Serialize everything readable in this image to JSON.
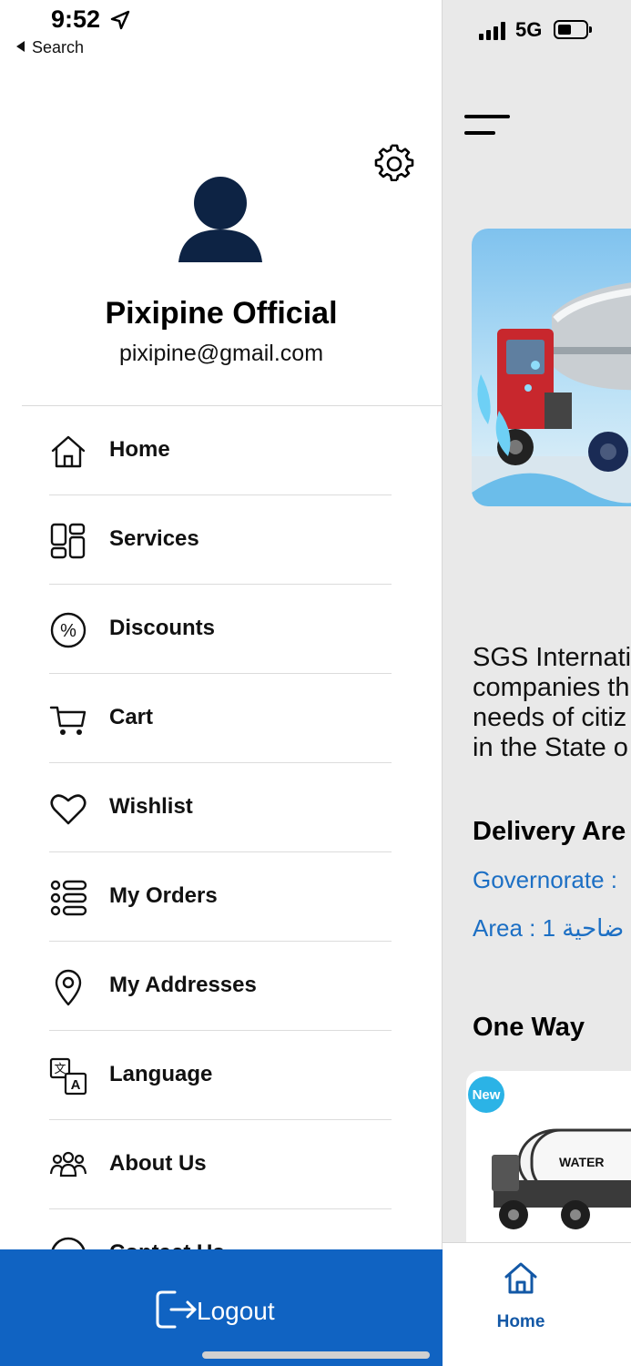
{
  "status_bar": {
    "time": "9:52",
    "back_label": "Search",
    "network": "5G"
  },
  "drawer": {
    "user_name": "Pixipine Official",
    "user_email": "pixipine@gmail.com",
    "menu_items": [
      {
        "label": "Home",
        "icon": "home-icon"
      },
      {
        "label": "Services",
        "icon": "services-grid-icon"
      },
      {
        "label": "Discounts",
        "icon": "percent-icon"
      },
      {
        "label": "Cart",
        "icon": "cart-icon"
      },
      {
        "label": "Wishlist",
        "icon": "heart-icon"
      },
      {
        "label": "My Orders",
        "icon": "list-icon"
      },
      {
        "label": "My Addresses",
        "icon": "location-pin-icon"
      },
      {
        "label": "Language",
        "icon": "language-icon"
      },
      {
        "label": "About Us",
        "icon": "people-icon"
      },
      {
        "label": "Contact Us",
        "icon": "contact-icon"
      }
    ],
    "logout_label": "Logout",
    "accent_color": "#1063c2"
  },
  "background_app": {
    "description": "SGS Internati\ncompanies th\nneeds of citiz\nin the State o",
    "delivery_title": "Delivery Are",
    "governorate": "Governorate : ",
    "area": "Area : ضاحية 1",
    "section_title": "One Way",
    "product_badge": "New",
    "product_tank_text": "WATER",
    "tab_home_label": "Home",
    "link_color": "#1c6fc4"
  }
}
